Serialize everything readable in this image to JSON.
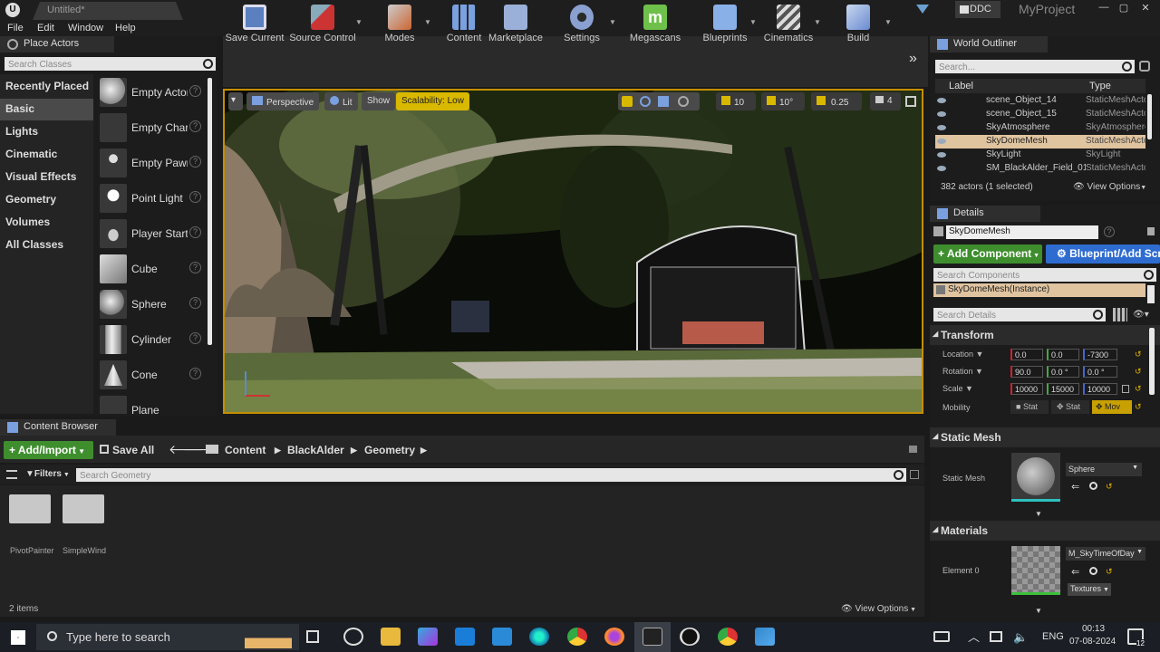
{
  "app": {
    "tab_title": "Untitled*",
    "source_control_badge": "DDC",
    "project_name": "MyProject"
  },
  "menu": [
    "File",
    "Edit",
    "Window",
    "Help"
  ],
  "place_actors": {
    "title": "Place Actors",
    "search_placeholder": "Search Classes",
    "categories": [
      "Recently Placed",
      "Basic",
      "Lights",
      "Cinematic",
      "Visual Effects",
      "Geometry",
      "Volumes",
      "All Classes"
    ],
    "selected_category": "Basic",
    "items": [
      "Empty Actor",
      "Empty Character",
      "Empty Pawn",
      "Point Light",
      "Player Start",
      "Cube",
      "Sphere",
      "Cylinder",
      "Cone",
      "Plane"
    ]
  },
  "toolbar": {
    "buttons": [
      "Save Current",
      "Source Control",
      "Modes",
      "Content",
      "Marketplace",
      "Settings",
      "Megascans",
      "Blueprints",
      "Cinematics",
      "Build"
    ]
  },
  "viewport": {
    "perspective": "Perspective",
    "lit": "Lit",
    "show": "Show",
    "scalability": "Scalability: Low",
    "grid_snap": "10",
    "rot_snap": "10°",
    "scale_snap": "0.25",
    "camera_speed": "4"
  },
  "content_browser": {
    "title": "Content Browser",
    "add_import": "Add/Import",
    "save_all": "Save All",
    "breadcrumb": [
      "Content",
      "BlackAlder",
      "Geometry"
    ],
    "filters": "Filters",
    "search_placeholder": "Search Geometry",
    "folders": [
      "PivotPainter",
      "SimpleWind"
    ],
    "item_count": "2 items",
    "view_options": "View Options"
  },
  "world_outliner": {
    "title": "World Outliner",
    "search_placeholder": "Search...",
    "col_label": "Label",
    "col_type": "Type",
    "rows": [
      {
        "label": "scene_Object_14",
        "type": "StaticMeshActor"
      },
      {
        "label": "scene_Object_15",
        "type": "StaticMeshActor"
      },
      {
        "label": "SkyAtmosphere",
        "type": "SkyAtmosphere"
      },
      {
        "label": "SkyDomeMesh",
        "type": "StaticMeshActor"
      },
      {
        "label": "SkyLight",
        "type": "SkyLight"
      },
      {
        "label": "SM_BlackAlder_Field_01",
        "type": "StaticMeshActor"
      }
    ],
    "selected_row": "SkyDomeMesh",
    "status": "382 actors (1 selected)",
    "view_options": "View Options"
  },
  "details": {
    "title": "Details",
    "actor_name": "SkyDomeMesh",
    "add_component": "Add Component",
    "blueprint_button": "Blueprint/Add Script",
    "search_components": "Search Components",
    "component_instance": "SkyDomeMesh(Instance)",
    "search_details": "Search Details",
    "transform": {
      "header": "Transform",
      "location_label": "Location",
      "location": [
        "0.0",
        "0.0",
        "-7300"
      ],
      "rotation_label": "Rotation",
      "rotation": [
        "90.0",
        "0.0 °",
        "0.0 °"
      ],
      "scale_label": "Scale",
      "scale": [
        "10000",
        "15000",
        "10000"
      ],
      "mobility_label": "Mobility",
      "mobility": [
        "Stat",
        "Stat",
        "Mov"
      ]
    },
    "static_mesh": {
      "header": "Static Mesh",
      "label": "Static Mesh",
      "value": "Sphere"
    },
    "materials": {
      "header": "Materials",
      "element_label": "Element 0",
      "value": "M_SkyTimeOfDay",
      "textures": "Textures"
    }
  },
  "taskbar": {
    "search_text": "Type here to search",
    "language": "ENG",
    "time": "00:13",
    "date": "07-08-2024",
    "notifications": "12"
  }
}
